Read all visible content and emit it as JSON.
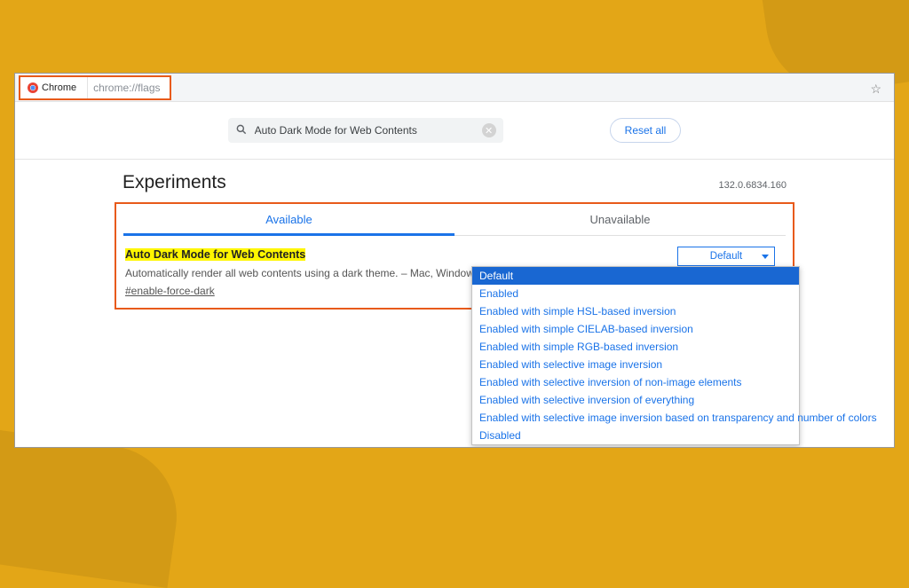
{
  "address_bar": {
    "label": "Chrome",
    "url": "chrome://flags"
  },
  "search": {
    "value": "Auto Dark Mode for Web Contents"
  },
  "reset_label": "Reset all",
  "heading": "Experiments",
  "version": "132.0.6834.160",
  "tabs": {
    "available": "Available",
    "unavailable": "Unavailable"
  },
  "flag": {
    "title": "Auto Dark Mode for Web Contents",
    "description": "Automatically render all web contents using a dark theme. – Mac, Windows, Linux, ChromeOS, Android, Lacros",
    "hash": "#enable-force-dark",
    "selected": "Default"
  },
  "dropdown_options": [
    "Default",
    "Enabled",
    "Enabled with simple HSL-based inversion",
    "Enabled with simple CIELAB-based inversion",
    "Enabled with simple RGB-based inversion",
    "Enabled with selective image inversion",
    "Enabled with selective inversion of non-image elements",
    "Enabled with selective inversion of everything",
    "Enabled with selective image inversion based on transparency and number of colors",
    "Disabled"
  ]
}
